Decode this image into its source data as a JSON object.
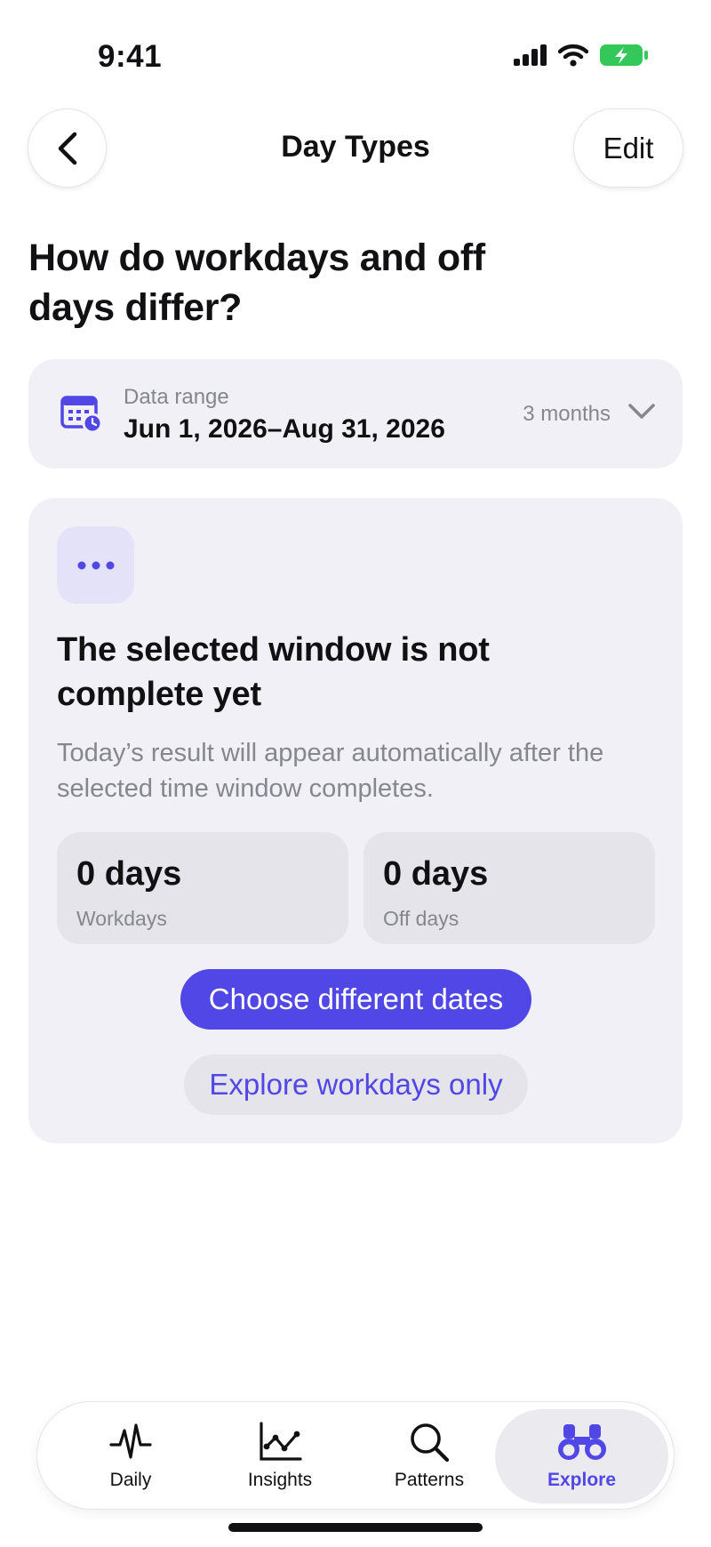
{
  "status_bar": {
    "time": "9:41",
    "icons": [
      "signal-icon",
      "wifi-icon",
      "battery-charging-icon"
    ]
  },
  "nav": {
    "title": "Day Types",
    "back_icon": "chevron-left-icon",
    "edit_label": "Edit"
  },
  "question": "How do workdays and off days differ?",
  "range": {
    "icon": "calendar-icon",
    "label": "Data range",
    "value": "Jun 1, 2026–Aug 31, 2026",
    "duration": "3 months",
    "chevron": "chevron-down-icon"
  },
  "status_card": {
    "icon": "ellipsis-icon",
    "title": "The selected window is not complete yet",
    "description": "Today’s result will appear automatically after the selected time window completes.",
    "stats": [
      {
        "value": "0 days",
        "label": "Workdays"
      },
      {
        "value": "0 days",
        "label": "Off days"
      }
    ],
    "primary_action": "Choose different dates",
    "secondary_action": "Explore workdays only"
  },
  "tabs": [
    {
      "label": "Daily",
      "icon": "heartbeat-icon",
      "selected": false
    },
    {
      "label": "Insights",
      "icon": "line-chart-icon",
      "selected": false
    },
    {
      "label": "Patterns",
      "icon": "magnifier-icon",
      "selected": false
    },
    {
      "label": "Explore",
      "icon": "binoculars-icon",
      "selected": true
    }
  ],
  "colors": {
    "accent": "#5146e6",
    "card_background": "#f0f0f6",
    "secondary_text": "#86868f",
    "battery_green": "#34c759"
  }
}
